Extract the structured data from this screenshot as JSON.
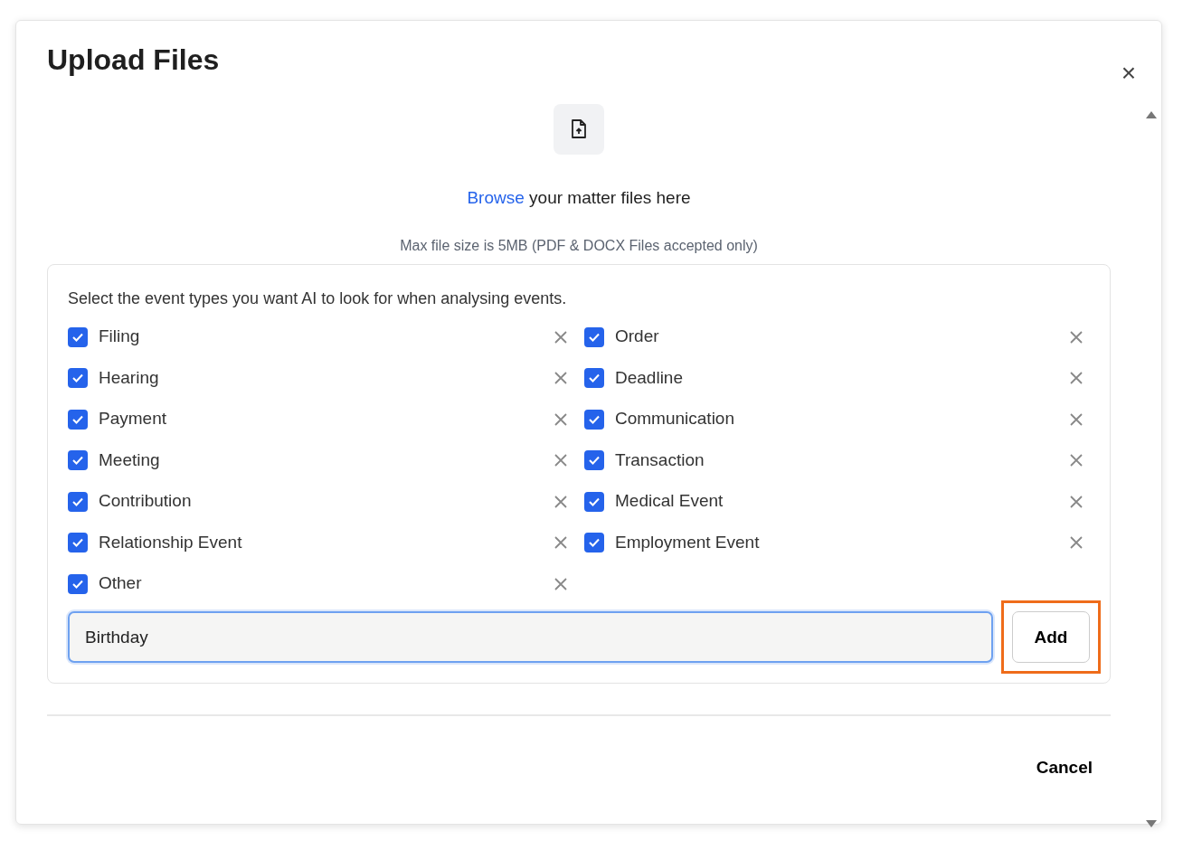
{
  "dialog": {
    "title": "Upload Files",
    "close_label": "×"
  },
  "upload": {
    "browse_link": "Browse",
    "browse_rest": " your matter files here",
    "hint": "Max file size is 5MB (PDF & DOCX Files accepted only)"
  },
  "events": {
    "instruction": "Select the event types you want AI to look for when analysing events.",
    "items": [
      {
        "label": "Filing",
        "checked": true
      },
      {
        "label": "Order",
        "checked": true
      },
      {
        "label": "Hearing",
        "checked": true
      },
      {
        "label": "Deadline",
        "checked": true
      },
      {
        "label": "Payment",
        "checked": true
      },
      {
        "label": "Communication",
        "checked": true
      },
      {
        "label": "Meeting",
        "checked": true
      },
      {
        "label": "Transaction",
        "checked": true
      },
      {
        "label": "Contribution",
        "checked": true
      },
      {
        "label": "Medical Event",
        "checked": true
      },
      {
        "label": "Relationship Event",
        "checked": true
      },
      {
        "label": "Employment Event",
        "checked": true
      },
      {
        "label": "Other",
        "checked": true
      }
    ],
    "input": {
      "value": "Birthday"
    },
    "add_button": {
      "label": "Add",
      "highlighted": true
    }
  },
  "footer": {
    "cancel": "Cancel"
  }
}
